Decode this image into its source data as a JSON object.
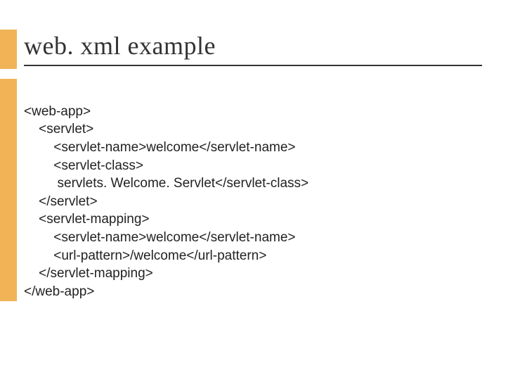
{
  "title": "web. xml example",
  "code": {
    "l1": "<web-app>",
    "l2": "    <servlet>",
    "l3": "        <servlet-name>welcome</servlet-name>",
    "l4": "        <servlet-class>",
    "l5": "         servlets. Welcome. Servlet</servlet-class>",
    "l6": "    </servlet>",
    "l7": "    <servlet-mapping>",
    "l8": "        <servlet-name>welcome</servlet-name>",
    "l9": "        <url-pattern>/welcome</url-pattern>",
    "l10": "    </servlet-mapping>",
    "l11": "</web-app>"
  }
}
